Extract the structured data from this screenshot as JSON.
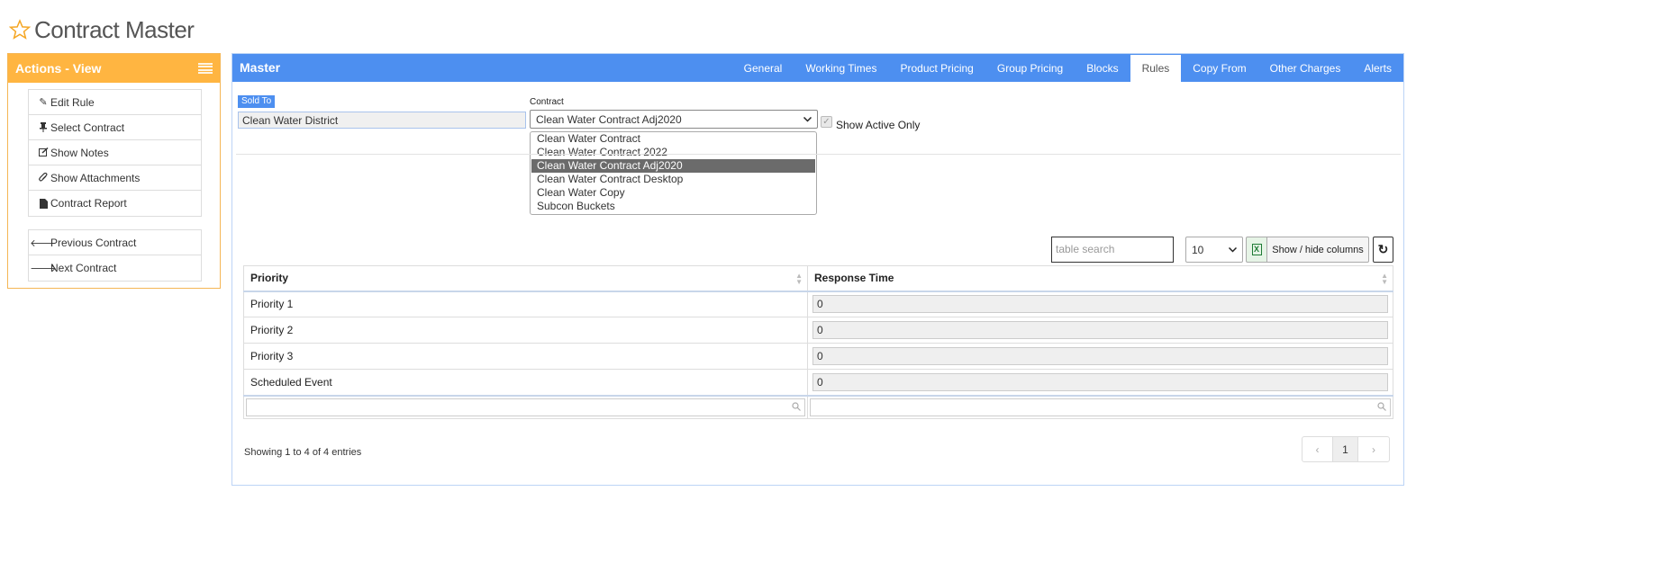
{
  "page": {
    "title": "Contract Master"
  },
  "actions": {
    "title": "Actions - View",
    "group1": [
      {
        "label": "Edit Rule",
        "icon": "pencil-icon"
      },
      {
        "label": "Select Contract",
        "icon": "pin-icon"
      },
      {
        "label": "Show Notes",
        "icon": "edit-square-icon"
      },
      {
        "label": "Show Attachments",
        "icon": "paperclip-icon"
      },
      {
        "label": "Contract Report",
        "icon": "file-icon"
      }
    ],
    "group2": [
      {
        "label": "Previous Contract",
        "icon": "arrow-left-icon"
      },
      {
        "label": "Next Contract",
        "icon": "arrow-right-icon"
      }
    ]
  },
  "master": {
    "title": "Master",
    "tabs": [
      "General",
      "Working Times",
      "Product Pricing",
      "Group Pricing",
      "Blocks",
      "Rules",
      "Copy From",
      "Other Charges",
      "Alerts"
    ],
    "active_tab": "Rules"
  },
  "form": {
    "sold_to_label": "Sold To",
    "sold_to_value": "Clean Water District",
    "contract_label": "Contract",
    "contract_value": "Clean Water Contract Adj2020",
    "show_active_label": "Show Active Only",
    "contract_options": [
      "Clean Water Contract",
      "Clean Water Contract 2022",
      "Clean Water Contract Adj2020",
      "Clean Water Contract Desktop",
      "Clean Water Copy",
      "Subcon Buckets"
    ]
  },
  "table": {
    "search_placeholder": "table search",
    "page_size": "10",
    "excel_label": "X",
    "cols_button": "Show / hide columns",
    "refresh_label": "↻",
    "headers": [
      "Priority",
      "Response Time"
    ],
    "rows": [
      {
        "priority": "Priority 1",
        "response": "0"
      },
      {
        "priority": "Priority 2",
        "response": "0"
      },
      {
        "priority": "Priority 3",
        "response": "0"
      },
      {
        "priority": "Scheduled Event",
        "response": "0"
      }
    ],
    "showing": "Showing 1 to 4 of 4 entries",
    "pager": {
      "prev": "‹",
      "current": "1",
      "next": "›"
    }
  },
  "colors": {
    "accent": "#4d8ff0",
    "actions": "#ffb541",
    "selected_option": "#6b6b6b"
  }
}
